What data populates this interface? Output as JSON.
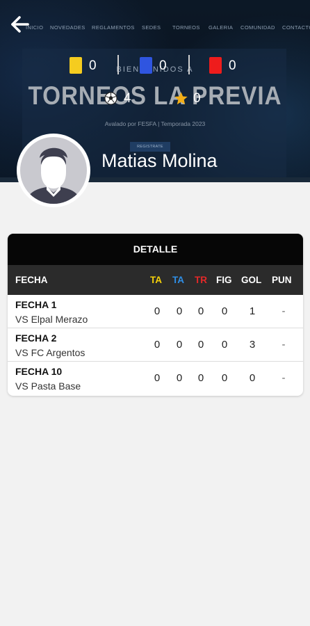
{
  "banner": {
    "nav_items": [
      "INICIO",
      "NOVEDADES",
      "REGLAMENTOS",
      "SEDES",
      "TORNEOS",
      "GALERIA",
      "COMUNIDAD",
      "CONTACTO"
    ],
    "welcome": "BIENVENIDOS A",
    "title": "TORNEOS LA PREVIA",
    "subtitle": "Avalado por FESFA | Temporada 2023",
    "register_label": "REGISTRATE"
  },
  "player": {
    "name": "Matias Molina",
    "stats": {
      "yellow_cards": "0",
      "blue_cards": "0",
      "red_cards": "0",
      "goals": "4",
      "stars": "0"
    }
  },
  "detail": {
    "title": "DETALLE",
    "columns": {
      "fecha": "FECHA",
      "ta_yellow": "TA",
      "ta_blue": "TA",
      "tr": "TR",
      "fig": "FIG",
      "gol": "GOL",
      "pun": "PUN"
    },
    "rows": [
      {
        "fecha": "FECHA 1",
        "vs": "VS Elpal Merazo",
        "ta_yellow": "0",
        "ta_blue": "0",
        "tr": "0",
        "fig": "0",
        "gol": "1",
        "pun": "-"
      },
      {
        "fecha": "FECHA 2",
        "vs": "VS FC Argentos",
        "ta_yellow": "0",
        "ta_blue": "0",
        "tr": "0",
        "fig": "0",
        "gol": "3",
        "pun": "-"
      },
      {
        "fecha": "FECHA 10",
        "vs": "VS Pasta Base",
        "ta_yellow": "0",
        "ta_blue": "0",
        "tr": "0",
        "fig": "0",
        "gol": "0",
        "pun": "-"
      }
    ]
  },
  "colors": {
    "yellow_card": "#f5cc1f",
    "blue_card": "#2f55e0",
    "red_card": "#ee1c1c",
    "ta_yellow_header": "#f5d10a",
    "ta_blue_header": "#2f8fe6",
    "tr_header": "#e62828",
    "table_header_bg": "#060606",
    "column_header_bg": "#2b2b2b"
  },
  "icons": {
    "back": "arrow-left-icon",
    "goal": "soccer-ball-icon",
    "star": "star-icon",
    "avatar": "user-silhouette-icon"
  }
}
